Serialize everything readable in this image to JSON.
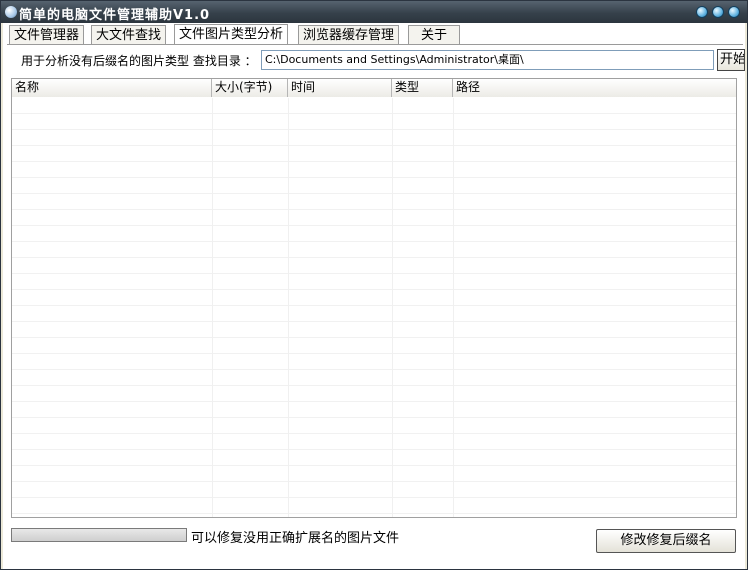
{
  "window": {
    "title": "简单的电脑文件管理辅助V1.0"
  },
  "tabs": [
    {
      "label": "文件管理器"
    },
    {
      "label": "大文件查找"
    },
    {
      "label": "文件图片类型分析"
    },
    {
      "label": "浏览器缓存管理"
    },
    {
      "label": "关于"
    }
  ],
  "active_tab": "文件图片类型分析",
  "search": {
    "label": "用于分析没有后缀名的图片类型 查找目录 ：",
    "path_value": "C:\\Documents and Settings\\Administrator\\桌面\\",
    "start_button": "开始"
  },
  "table": {
    "columns": [
      "名称",
      "大小(字节)",
      "时间",
      "类型",
      "路径"
    ],
    "rows": []
  },
  "footer": {
    "progress": 0,
    "status": "可以修复没用正确扩展名的图片文件",
    "fix_button": "修改修复后缀名"
  }
}
